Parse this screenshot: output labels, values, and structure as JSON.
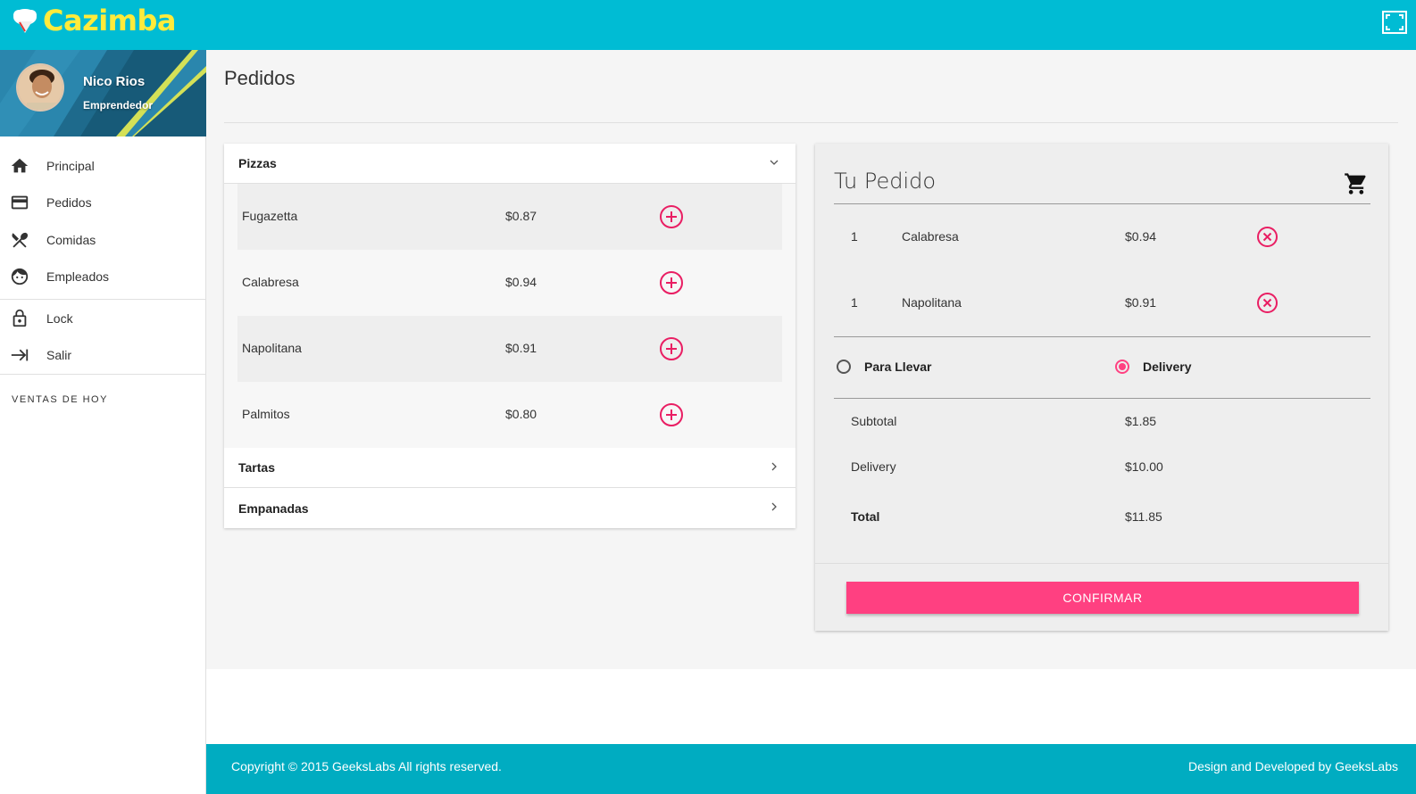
{
  "app": {
    "name": "Cazimba",
    "logo_icon": "chef-hat-icon",
    "fullscreen_icon": "fullscreen-icon"
  },
  "colors": {
    "primary": "#00bcd4",
    "footer": "#00acc1",
    "accent": "#ff4081",
    "brand_text": "#ffeb3b"
  },
  "profile": {
    "name": "Nico Rios",
    "role": "Emprendedor"
  },
  "sidebar": {
    "items": [
      {
        "label": "Principal",
        "icon": "home-icon"
      },
      {
        "label": "Pedidos",
        "icon": "credit-card-icon"
      },
      {
        "label": "Comidas",
        "icon": "utensils-icon"
      },
      {
        "label": "Empleados",
        "icon": "face-icon"
      },
      {
        "label": "Lock",
        "icon": "lock-icon"
      },
      {
        "label": "Salir",
        "icon": "exit-icon"
      }
    ],
    "section_label": "VENTAS DE HOY"
  },
  "page": {
    "title": "Pedidos"
  },
  "menu": {
    "categories": [
      {
        "label": "Pizzas",
        "expanded": true
      },
      {
        "label": "Tartas",
        "expanded": false
      },
      {
        "label": "Empanadas",
        "expanded": false
      }
    ],
    "products": [
      {
        "name": "Fugazetta",
        "price": "$0.87"
      },
      {
        "name": "Calabresa",
        "price": "$0.94"
      },
      {
        "name": "Napolitana",
        "price": "$0.91"
      },
      {
        "name": "Palmitos",
        "price": "$0.80"
      }
    ]
  },
  "order": {
    "title": "Tu Pedido",
    "items": [
      {
        "qty": "1",
        "name": "Calabresa",
        "price": "$0.94"
      },
      {
        "qty": "1",
        "name": "Napolitana",
        "price": "$0.91"
      }
    ],
    "options": [
      {
        "label": "Para Llevar",
        "checked": false
      },
      {
        "label": "Delivery",
        "checked": true
      }
    ],
    "subtotal_label": "Subtotal",
    "subtotal_value": "$1.85",
    "delivery_label": "Delivery",
    "delivery_value": "$10.00",
    "total_label": "Total",
    "total_value": "$11.85",
    "confirm_label": "CONFIRMAR"
  },
  "footer": {
    "copyright": "Copyright © 2015 GeeksLabs All rights reserved.",
    "credit": "Design and Developed by GeeksLabs"
  }
}
